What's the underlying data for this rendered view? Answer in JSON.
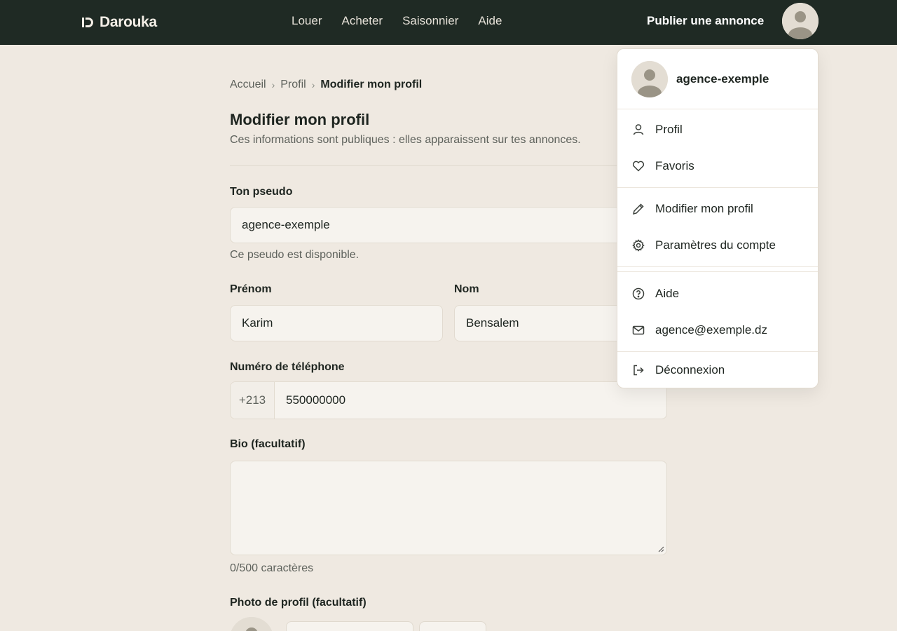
{
  "brand": {
    "name": "Darouka"
  },
  "nav": {
    "items": [
      "Louer",
      "Acheter",
      "Saisonnier",
      "Aide"
    ],
    "publish_label": "Publier une annonce"
  },
  "breadcrumb": [
    "Accueil",
    "Profil",
    "Modifier mon profil"
  ],
  "page": {
    "title": "Modifier mon profil",
    "subtitle": "Ces informations sont publiques : elles apparaissent sur tes annonces."
  },
  "form": {
    "pseudo": {
      "label": "Ton pseudo",
      "value": "agence-exemple",
      "help": "Ce pseudo est disponible."
    },
    "prenom": {
      "label": "Prénom",
      "value": "Karim"
    },
    "nom": {
      "label": "Nom",
      "value": "Bensalem"
    },
    "telephone": {
      "label": "Numéro de téléphone",
      "prefix": "+213",
      "value": "550000000"
    },
    "bio": {
      "label": "Bio (facultatif)",
      "value": "",
      "counter": "0/500 caractères"
    },
    "photo": {
      "label": "Photo de profil (facultatif)"
    }
  },
  "menu": {
    "username": "agence-exemple",
    "items": [
      {
        "label": "Profil",
        "icon": "user-icon"
      },
      {
        "label": "Favoris",
        "icon": "heart-icon"
      },
      {
        "label": "Modifier mon profil",
        "icon": "pencil-icon"
      },
      {
        "label": "Paramètres du compte",
        "icon": "gear-icon"
      },
      {
        "label": "Aide",
        "icon": "help-circle-icon"
      },
      {
        "label": "agence@exemple.dz",
        "icon": "mail-icon"
      },
      {
        "label": "Déconnexion",
        "icon": "logout-icon"
      }
    ]
  },
  "colors": {
    "topbar": "#1f2a24",
    "background": "#efe9e1",
    "field": "#f6f3ee",
    "text": "#1e2520",
    "muted": "#5e625c"
  }
}
